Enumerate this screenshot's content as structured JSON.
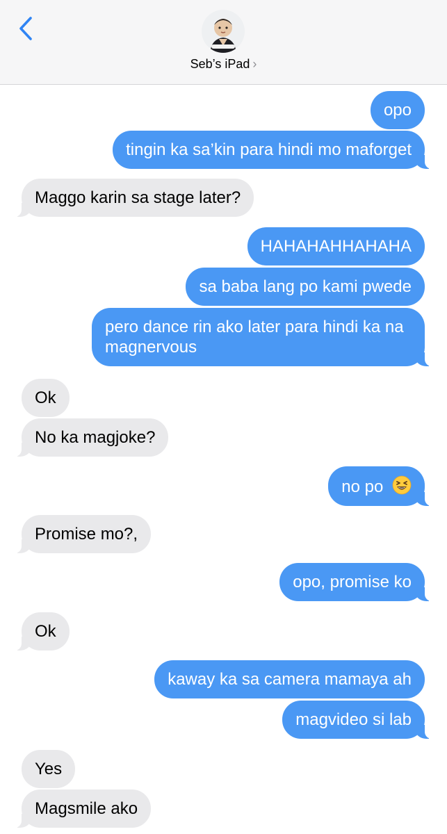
{
  "header": {
    "contact_name": "Seb’s iPad",
    "chevron": "›",
    "back_icon": "chevron-left-icon"
  },
  "messages": [
    {
      "from": "me",
      "text": "opo"
    },
    {
      "from": "me",
      "text": "tingin ka sa’kin para hindi mo maforget"
    },
    {
      "from": "them",
      "text": "Maggo karin sa stage later?"
    },
    {
      "from": "me",
      "text": "HAHAHAHHAHAHA"
    },
    {
      "from": "me",
      "text": "sa baba lang po kami pwede"
    },
    {
      "from": "me",
      "text": "pero dance rin ako later para hindi ka na magnervous"
    },
    {
      "from": "them",
      "text": "Ok"
    },
    {
      "from": "them",
      "text": "No ka magjoke?"
    },
    {
      "from": "me",
      "text": "no po",
      "emoji": "grinning-squinting-face"
    },
    {
      "from": "them",
      "text": "Promise mo?,"
    },
    {
      "from": "me",
      "text": "opo, promise ko"
    },
    {
      "from": "them",
      "text": "Ok"
    },
    {
      "from": "me",
      "text": "kaway ka sa camera mamaya ah"
    },
    {
      "from": "me",
      "text": "magvideo si lab"
    },
    {
      "from": "them",
      "text": "Yes"
    },
    {
      "from": "them",
      "text": "Magsmile ako"
    }
  ],
  "colors": {
    "sent_bubble": "#4a98f4",
    "received_bubble": "#e9e9eb",
    "accent": "#2f84f4"
  }
}
